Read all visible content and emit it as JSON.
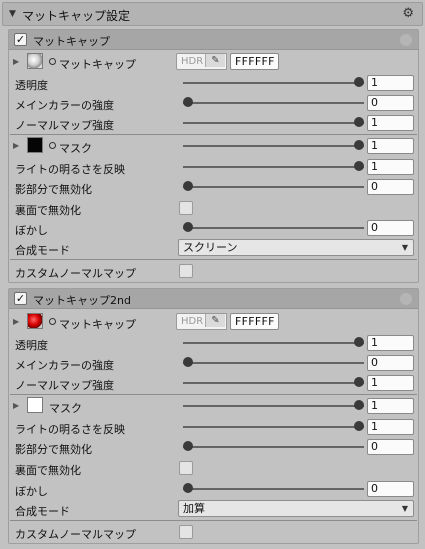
{
  "header": {
    "title": "マットキャップ設定"
  },
  "panel1": {
    "title": "マットキャップ",
    "texture": {
      "label": "マットキャップ",
      "hdr": "HDR",
      "color": "FFFFFF"
    },
    "opacity": {
      "label": "透明度",
      "value": "1",
      "fraction": 1.0
    },
    "main_color_strength": {
      "label": "メインカラーの強度",
      "value": "0",
      "fraction": 0.0
    },
    "normal_map_strength": {
      "label": "ノーマルマップ強度",
      "value": "1",
      "fraction": 1.0
    },
    "mask": {
      "label": "マスク",
      "value": "1",
      "fraction": 1.0
    },
    "light_reflect": {
      "label": "ライトの明るさを反映",
      "value": "1",
      "fraction": 1.0
    },
    "shadow_disable": {
      "label": "影部分で無効化",
      "value": "0",
      "fraction": 0.0
    },
    "backface_disable": {
      "label": "裏面で無効化"
    },
    "blur": {
      "label": "ぼかし",
      "value": "0",
      "fraction": 0.0
    },
    "blend_mode": {
      "label": "合成モード",
      "value": "スクリーン"
    },
    "custom_normal": {
      "label": "カスタムノーマルマップ"
    }
  },
  "panel2": {
    "title": "マットキャップ2nd",
    "texture": {
      "label": "マットキャップ",
      "hdr": "HDR",
      "color": "FFFFFF"
    },
    "opacity": {
      "label": "透明度",
      "value": "1",
      "fraction": 1.0
    },
    "main_color_strength": {
      "label": "メインカラーの強度",
      "value": "0",
      "fraction": 0.0
    },
    "normal_map_strength": {
      "label": "ノーマルマップ強度",
      "value": "1",
      "fraction": 1.0
    },
    "mask": {
      "label": "マスク",
      "value": "1",
      "fraction": 1.0
    },
    "light_reflect": {
      "label": "ライトの明るさを反映",
      "value": "1",
      "fraction": 1.0
    },
    "shadow_disable": {
      "label": "影部分で無効化",
      "value": "0",
      "fraction": 0.0
    },
    "backface_disable": {
      "label": "裏面で無効化"
    },
    "blur": {
      "label": "ぼかし",
      "value": "0",
      "fraction": 0.0
    },
    "blend_mode": {
      "label": "合成モード",
      "value": "加算"
    },
    "custom_normal": {
      "label": "カスタムノーマルマップ"
    }
  }
}
